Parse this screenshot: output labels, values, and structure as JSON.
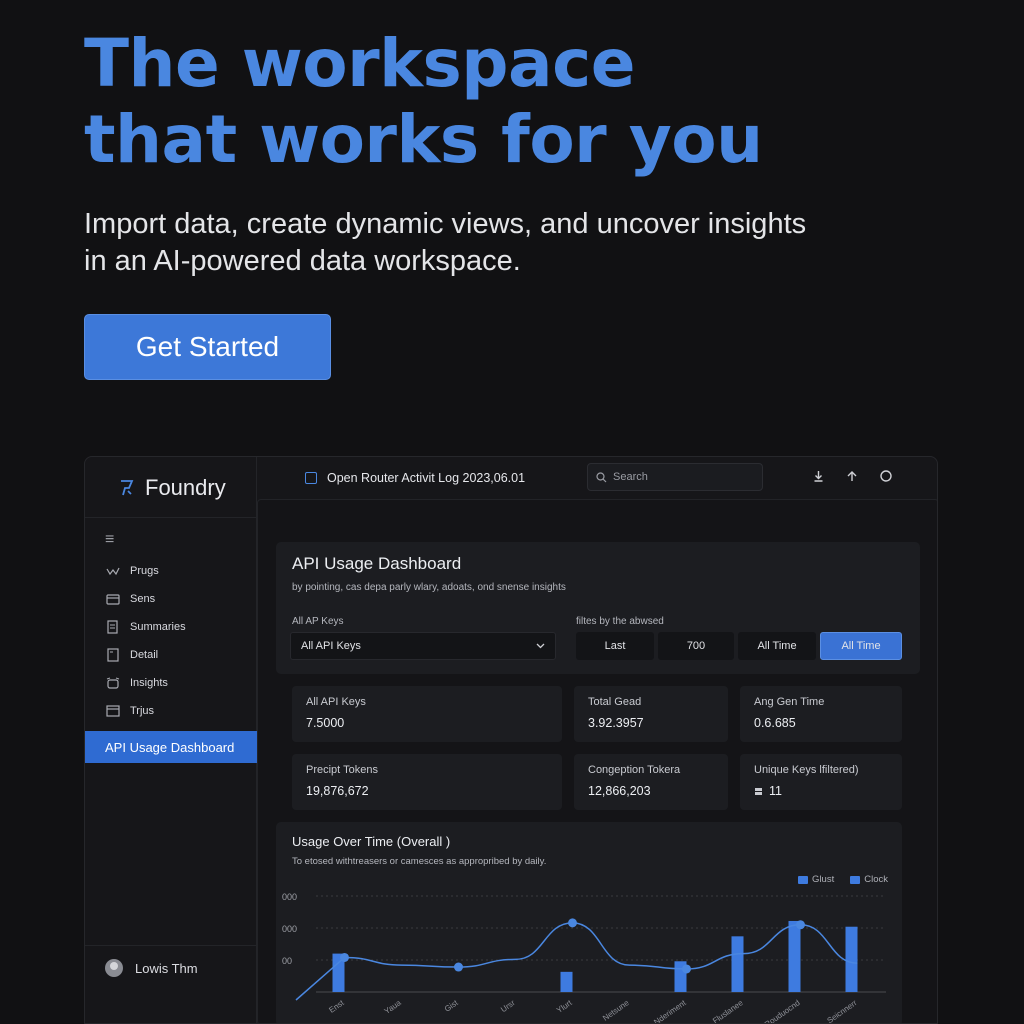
{
  "hero": {
    "title_line1": "The workspace",
    "title_line2": "that works for you",
    "subtitle_line1": "Import data, create dynamic views, and uncover insights",
    "subtitle_line2": "in an AI-powered data workspace.",
    "cta_label": "Get Started"
  },
  "colors": {
    "accent": "#4a87e0",
    "button": "#3d78d8",
    "active_nav": "#2f6bd2",
    "background": "#111113"
  },
  "app": {
    "brand": "Foundry",
    "document_title": "Open Router Activit Log 2023,06.01",
    "search_placeholder": "Search",
    "top_icons": [
      "download-icon",
      "upload-icon",
      "circle-icon"
    ],
    "sidebar": {
      "items": [
        {
          "label": "Prugs",
          "icon": "chart-line-icon"
        },
        {
          "label": "Sens",
          "icon": "card-icon"
        },
        {
          "label": "Summaries",
          "icon": "document-icon"
        },
        {
          "label": "Detail",
          "icon": "page-icon"
        },
        {
          "label": "Insights",
          "icon": "alarm-icon"
        },
        {
          "label": "Trjus",
          "icon": "window-icon"
        }
      ],
      "active_item": "API Usage Dashboard",
      "user_name": "Lowis Thm"
    },
    "dashboard": {
      "title": "API Usage Dashboard",
      "subtitle": "by pointing, cas depa parly wlary, adoats, ond snense insights",
      "keys_label": "All AP Keys",
      "keys_value": "All API Keys",
      "filter_label": "filtes by the abwsed",
      "segments": [
        "Last",
        "700",
        "All Time",
        "All Time"
      ],
      "active_segment": 3,
      "cards": [
        {
          "title": "All API Keys",
          "value": "7.5000"
        },
        {
          "title": "Total Gead",
          "value": "3.92.3957"
        },
        {
          "title": "Ang Gen Time",
          "value": "0.6.685"
        },
        {
          "title": "Precipt Tokens",
          "value": "19,876,672"
        },
        {
          "title": "Congeption Tokera",
          "value": "12,866,203"
        },
        {
          "title": "Unique Keys lfiltered)",
          "value": "11"
        }
      ]
    }
  },
  "chart_data": {
    "type": "bar",
    "title": "Usage Over Time (Overall )",
    "subtitle": "To etosed withtreasers or camesces as appropribed by daily.",
    "legend": [
      "Glust",
      "Clock"
    ],
    "y_tick_labels": [
      "000",
      "000",
      "00"
    ],
    "categories": [
      "Enst",
      "Yaua",
      "Gist",
      "Ursr",
      "Ylurt",
      "Netsune",
      "Nderiment",
      "Fluslanee",
      "Rouduocnd",
      "Seicnnerr"
    ],
    "series": [
      {
        "name": "Glust",
        "values": [
          40,
          null,
          null,
          null,
          21,
          null,
          32,
          58,
          74,
          68
        ]
      },
      {
        "name": "Clock",
        "values": [
          36,
          28,
          26,
          34,
          72,
          28,
          24,
          40,
          70,
          30
        ]
      }
    ],
    "ylim": [
      0,
      100
    ]
  }
}
